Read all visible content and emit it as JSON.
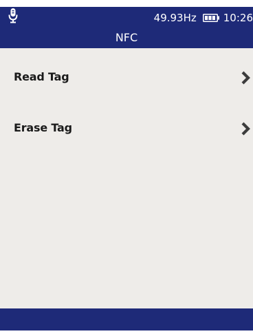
{
  "status_bar": {
    "frequency": "49.93Hz",
    "time": "10:26",
    "left_icon": "microphone-icon",
    "battery_icon": "battery-icon"
  },
  "header": {
    "title": "NFC"
  },
  "menu": {
    "items": [
      {
        "label": "Read Tag",
        "icon": "chevron-right-icon"
      },
      {
        "label": "Erase Tag",
        "icon": "chevron-right-icon"
      }
    ]
  },
  "colors": {
    "header_bg": "#1e2a78",
    "content_bg": "#eeece9",
    "footer_bg": "#1e2a78",
    "chevron": "#3c3c3c"
  }
}
